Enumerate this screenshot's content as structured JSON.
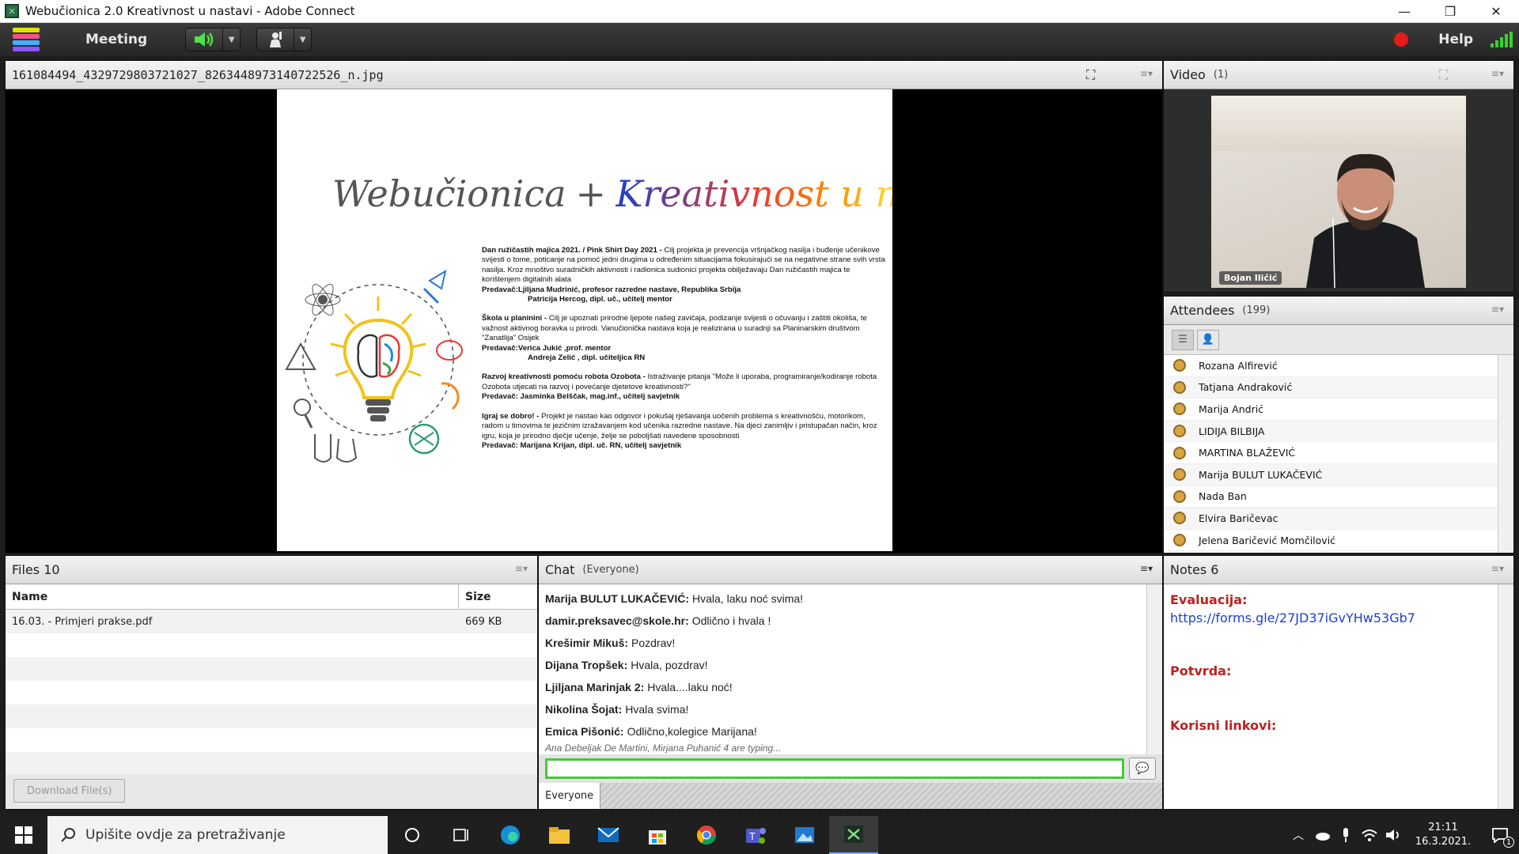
{
  "window": {
    "title": "Webučionica 2.0 Kreativnost u nastavi - Adobe Connect",
    "controls": [
      "minimize-icon",
      "restore-icon",
      "close-icon"
    ]
  },
  "menubar": {
    "meeting_label": "Meeting",
    "help_label": "Help"
  },
  "share_pod": {
    "title": "161084494_4329729803721027_8263448973140722526_n.jpg",
    "slide": {
      "wordmark_left": "Webučionica",
      "plus": "+",
      "wordmark_right": "Kreativnost u nastavi",
      "sections": [
        {
          "lead": "Dan ružičastih majica 2021. / Pink Shirt Day 2021 -",
          "body": " Cilj projekta je prevencija vršnjačkog nasilja i buđenje učenikove svijesti o tome, poticanje na pomoć jedni drugima u određenim situacijama fokusirajući se na negativne strane svih vrsta nasilja. Kroz mnoštvo suradničkih aktivnosti i radionica sudionici projekta obilježavaju Dan ružičastih majica te korištenjem digitalnih alata",
          "presenter_line1": "Predavač:Ljiljana Mudrinić, profesor razredne nastave, Republika Srbija",
          "presenter_line2": "Patricija Hercog, dipl. uč., učitelj mentor"
        },
        {
          "lead": "Škola u planinini -",
          "body": " Cilj je upoznati prirodne ljepote našeg zavičaja, podizanje svijesti o očuvanju i zaštiti okoliša, te važnost aktivnog boravka u prirodi. Vanučionička nastava koja je realizirana u suradnji sa Planinarskim društvom \"Zanatlija\" Osijek",
          "presenter_line1": "Predavač:Verica Jukić ,prof. mentor",
          "presenter_line2": "Andreja Zelić , dipl. učiteljica RN"
        },
        {
          "lead": "Razvoj kreativnosti pomoću robota Ozobota -",
          "body": " Istraživanje pitanja \"Može li uporaba, programiranje/kodiranje robota Ozobota utjecati na razvoj i povećanje djetetove kreativnosti?\"",
          "presenter_line1": "Predavač: Jasminka Belščak, mag.inf., učitelj savjetnik",
          "presenter_line2": ""
        },
        {
          "lead": "Igraj se dobro! -",
          "body": " Projekt je nastao kao odgovor i pokušaj rješavanja uočenih problema s kreativnošću, motorikom, radom u timovima te jezičnim izražavanjem kod učenika razredne nastave. Na djeci zanimljiv i pristupačan način, kroz igru, koja je prirodno dječje učenje, želje se poboljšati navedene sposobnosti",
          "presenter_line1": "Predavač: Marijana Krijan, dipl. uč. RN, učitelj savjetnik",
          "presenter_line2": ""
        }
      ]
    }
  },
  "video_pod": {
    "title": "Video",
    "count": "(1)",
    "camera_name": "Bojan Iličić"
  },
  "attendees_pod": {
    "title": "Attendees",
    "count": "(199)",
    "list": [
      "Rozana Alfirević",
      "Tatjana Andraković",
      "Marija Andrić",
      "LIDIJA BILBIJA",
      "MARTINA BLAŽEVIĆ",
      "Marija BULUT LUKAČEVIĆ",
      "Nada Ban",
      "Elvira Baričevac",
      "Jelena Baričević Momčilović"
    ]
  },
  "files_pod": {
    "title": "Files 10",
    "col_name": "Name",
    "col_size": "Size",
    "files": [
      {
        "name": "16.03. - Primjeri prakse.pdf",
        "size": "669 KB"
      }
    ],
    "download_label": "Download File(s)"
  },
  "chat_pod": {
    "title": "Chat",
    "scope": "(Everyone)",
    "messages": [
      {
        "from": "Marija BULUT LUKAČEVIĆ:",
        "text": "Hvala, laku noć svima!"
      },
      {
        "from": "damir.preksavec@skole.hr:",
        "text": "Odlično i hvala !"
      },
      {
        "from": "Krešimir Mikuš:",
        "text": "Pozdrav!"
      },
      {
        "from": "Dijana Tropšek:",
        "text": "Hvala, pozdrav!"
      },
      {
        "from": "Ljiljana Marinjak 2:",
        "text": "Hvala....laku noć!"
      },
      {
        "from": "Nikolina Šojat:",
        "text": "Hvala svima!"
      },
      {
        "from": "Emica Pišonić:",
        "text": "Odlično,kolegice Marijana!"
      }
    ],
    "typing": "Ana Debeljak De Martini, Mirjana Puhanić 4 are typing...",
    "input_value": "",
    "tab_label": "Everyone"
  },
  "notes_pod": {
    "title": "Notes 6",
    "lines": {
      "eval_label": "Evaluacija:",
      "eval_link": "https://forms.gle/27JD37iGvYHw53Gb7",
      "potvrda_label": "Potvrda:",
      "links_label": "Korisni linkovi:"
    }
  },
  "taskbar": {
    "search_placeholder": "Upišite ovdje za pretraživanje",
    "time": "21:11",
    "date": "16.3.2021.",
    "notification_count": "1"
  },
  "colors": {
    "accent_green": "#39d12e",
    "record_red": "#e31b1b",
    "notes_red": "#c01f1f",
    "link_blue": "#1b3fd0"
  }
}
